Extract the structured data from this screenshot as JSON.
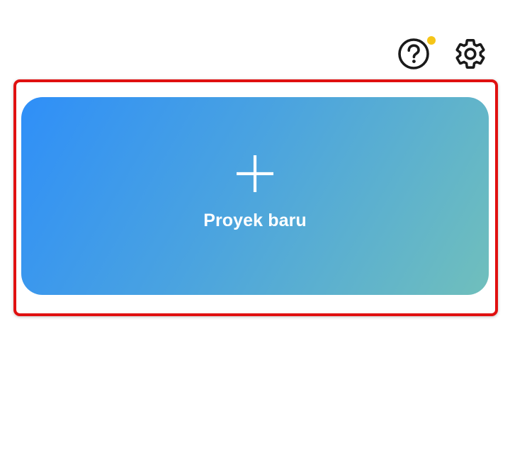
{
  "toolbar": {
    "help_icon": "help-circle-icon",
    "settings_icon": "gear-icon",
    "notification_dot_color": "#f5c518"
  },
  "new_project": {
    "icon": "plus-icon",
    "label": "Proyek baru",
    "gradient_start": "#2f8ff8",
    "gradient_end": "#70bfbc"
  },
  "highlight": {
    "border_color": "#e01010"
  }
}
